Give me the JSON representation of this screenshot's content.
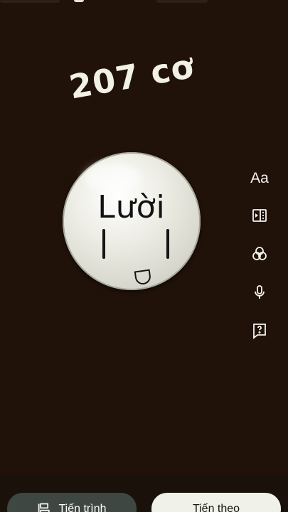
{
  "video": {
    "headline": "207 cơ",
    "ball_word": "Lười"
  },
  "tools": [
    {
      "name": "text",
      "label": "Aa",
      "icon": "text-icon"
    },
    {
      "name": "video",
      "icon": "video-clip-icon"
    },
    {
      "name": "filter",
      "icon": "filters-icon"
    },
    {
      "name": "voice",
      "icon": "microphone-icon"
    },
    {
      "name": "help",
      "icon": "help-question-icon"
    }
  ],
  "actions": {
    "progress_label": "Tiến trình",
    "next_label": "Tiến theo"
  },
  "colors": {
    "background": "#201208",
    "accent_light": "#f0f1e9",
    "button_dark": "#3e4741"
  }
}
